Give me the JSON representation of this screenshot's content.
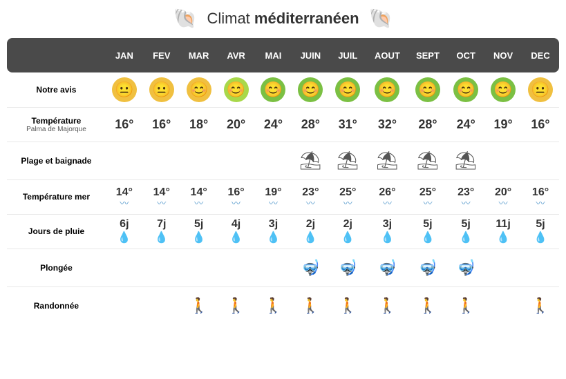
{
  "title": {
    "prefix": "Climat ",
    "main": "méditerranéen"
  },
  "months": [
    "JAN",
    "FEV",
    "MAR",
    "AVR",
    "MAI",
    "JUIN",
    "JUIL",
    "AOUT",
    "SEPT",
    "OCT",
    "NOV",
    "DEC"
  ],
  "rows": {
    "notre_avis": {
      "label": "Notre avis",
      "smileys": [
        "yellow",
        "yellow",
        "yellow",
        "green-light",
        "green",
        "green",
        "green",
        "green",
        "green",
        "green",
        "green",
        "yellow"
      ]
    },
    "temperature": {
      "label": "Température",
      "sublabel": "Palma de Majorque",
      "values": [
        "16°",
        "16°",
        "18°",
        "20°",
        "24°",
        "28°",
        "31°",
        "32°",
        "28°",
        "24°",
        "19°",
        "16°"
      ]
    },
    "plage": {
      "label": "Plage et baignade",
      "show": [
        false,
        false,
        false,
        false,
        false,
        true,
        true,
        true,
        true,
        true,
        false,
        false
      ]
    },
    "temperature_mer": {
      "label": "Température mer",
      "values": [
        "14°",
        "14°",
        "14°",
        "16°",
        "19°",
        "23°",
        "25°",
        "26°",
        "25°",
        "23°",
        "20°",
        "16°"
      ]
    },
    "jours_pluie": {
      "label": "Jours de pluie",
      "values": [
        "6j",
        "7j",
        "5j",
        "4j",
        "3j",
        "2j",
        "2j",
        "3j",
        "5j",
        "5j",
        "11j",
        "5j"
      ]
    },
    "plongee": {
      "label": "Plongée",
      "show": [
        false,
        false,
        false,
        false,
        false,
        true,
        true,
        true,
        true,
        true,
        false,
        false
      ]
    },
    "randonnee": {
      "label": "Randonnée",
      "show": [
        false,
        false,
        true,
        true,
        true,
        true,
        true,
        true,
        true,
        true,
        false,
        true
      ]
    }
  }
}
